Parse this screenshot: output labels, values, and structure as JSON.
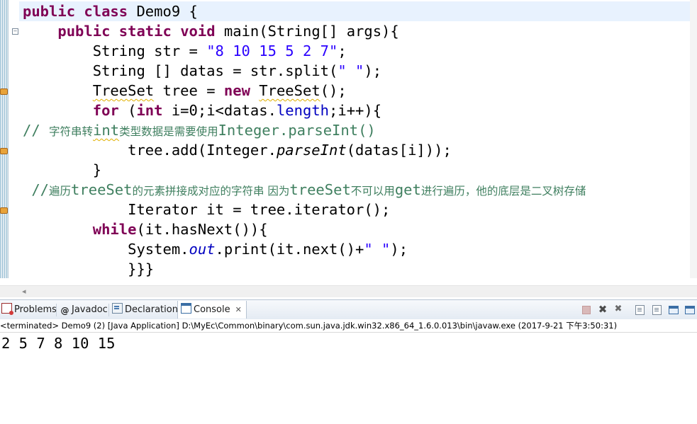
{
  "editor": {
    "lines": [
      {
        "segments": [
          {
            "t": "public",
            "c": "kw"
          },
          {
            "t": " "
          },
          {
            "t": "class",
            "c": "kw"
          },
          {
            "t": " Demo9 {"
          }
        ]
      },
      {
        "segments": [
          {
            "t": "    "
          },
          {
            "t": "public",
            "c": "kw"
          },
          {
            "t": " "
          },
          {
            "t": "static",
            "c": "kw"
          },
          {
            "t": " "
          },
          {
            "t": "void",
            "c": "kw"
          },
          {
            "t": " main(String[] args){"
          }
        ]
      },
      {
        "segments": [
          {
            "t": "        String str = "
          },
          {
            "t": "\"8 10 15 5 2 7\"",
            "c": "str"
          },
          {
            "t": ";"
          }
        ]
      },
      {
        "segments": [
          {
            "t": "        String [] datas = str.split("
          },
          {
            "t": "\" \"",
            "c": "str"
          },
          {
            "t": ");"
          }
        ]
      },
      {
        "segments": [
          {
            "t": "        "
          },
          {
            "t": "TreeSet",
            "c": "squig"
          },
          {
            "t": " tree = "
          },
          {
            "t": "new",
            "c": "kw"
          },
          {
            "t": " "
          },
          {
            "t": "TreeSet",
            "c": "squig"
          },
          {
            "t": "();"
          }
        ]
      },
      {
        "segments": [
          {
            "t": "        "
          },
          {
            "t": "for",
            "c": "kw"
          },
          {
            "t": " ("
          },
          {
            "t": "int",
            "c": "kw"
          },
          {
            "t": " i=0;i<datas."
          },
          {
            "t": "length",
            "c": "fld"
          },
          {
            "t": ";i++){"
          }
        ]
      },
      {
        "segments": [
          {
            "t": "// ",
            "c": "cmt"
          },
          {
            "t": "字符串转",
            "c": "cmt cjk"
          },
          {
            "t": "int",
            "c": "cmt squig"
          },
          {
            "t": "类型数据是需要使用",
            "c": "cmt cjk"
          },
          {
            "t": "Integer.parseInt()",
            "c": "cmt"
          }
        ]
      },
      {
        "segments": [
          {
            "t": "            "
          },
          {
            "t": "tree.add(Integer."
          },
          {
            "t": "parseInt",
            "c": "ital"
          },
          {
            "t": "(datas[i]));"
          }
        ]
      },
      {
        "segments": [
          {
            "t": "        }"
          }
        ]
      },
      {
        "segments": [
          {
            "t": " //",
            "c": "cmt"
          },
          {
            "t": "遍历",
            "c": "cmt cjk"
          },
          {
            "t": "treeSet",
            "c": "cmt"
          },
          {
            "t": "的元素拼接成对应的字符串 因为",
            "c": "cmt cjk"
          },
          {
            "t": "treeSet",
            "c": "cmt"
          },
          {
            "t": "不可以用",
            "c": "cmt cjk"
          },
          {
            "t": "get",
            "c": "cmt"
          },
          {
            "t": "进行遍历，他的底层是二叉树存储",
            "c": "cmt cjk"
          }
        ]
      },
      {
        "segments": [
          {
            "t": "            Iterator it = tree.iterator();"
          }
        ]
      },
      {
        "segments": [
          {
            "t": "        "
          },
          {
            "t": "while",
            "c": "kw"
          },
          {
            "t": "(it.hasNext()){"
          }
        ]
      },
      {
        "segments": [
          {
            "t": "            System."
          },
          {
            "t": "out",
            "c": "fldi"
          },
          {
            "t": ".print(it.next()+"
          },
          {
            "t": "\" \"",
            "c": "str"
          },
          {
            "t": ");"
          }
        ]
      },
      {
        "segments": [
          {
            "t": "            }}}"
          }
        ]
      }
    ]
  },
  "views": {
    "tabs": [
      {
        "name": "tab-problems",
        "icon": "problems-icon",
        "label": "Problems",
        "active": false
      },
      {
        "name": "tab-javadoc",
        "icon": "javadoc-icon",
        "label": "Javadoc",
        "active": false
      },
      {
        "name": "tab-declaration",
        "icon": "declaration-icon",
        "label": "Declaration",
        "active": false
      },
      {
        "name": "tab-console",
        "icon": "console-icon",
        "label": "Console",
        "active": true
      }
    ],
    "console_close_glyph": "✕",
    "javadoc_glyph": "@",
    "toolbar_icons": [
      "terminate-icon",
      "remove-launch-icon",
      "remove-all-terminated-icon",
      "scroll-lock-icon",
      "show-console-icon",
      "pin-console-icon",
      "display-selected-console-icon"
    ],
    "status_line": "<terminated> Demo9 (2) [Java Application] D:\\MyEc\\Common\\binary\\com.sun.java.jdk.win32.x86_64_1.6.0.013\\bin\\javaw.exe (2017-9-21 下午3:50:31)",
    "output": "2 5 7 8 10 15"
  },
  "colors": {
    "keyword": "#7f0055",
    "string": "#2a00ff",
    "field": "#0000c0",
    "comment": "#3f7f5f",
    "warning_squiggle": "#e0b000",
    "current_line": "#e8f2fe"
  }
}
